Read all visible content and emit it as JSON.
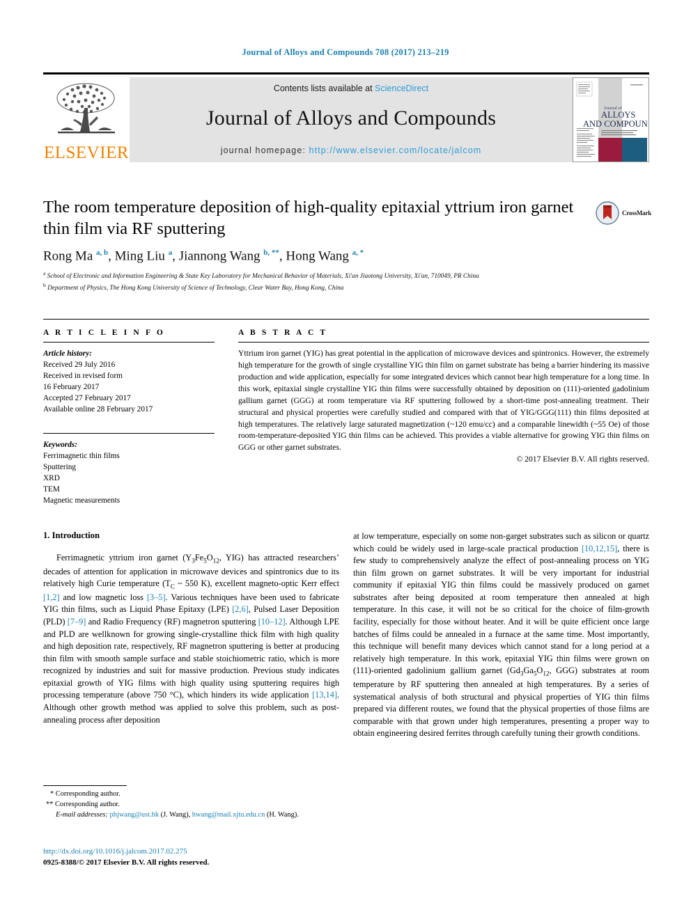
{
  "running_head": "Journal of Alloys and Compounds 708 (2017) 213–219",
  "masthead": {
    "publisher": "ELSEVIER",
    "contents_prefix": "Contents lists available at ",
    "contents_link": "ScienceDirect",
    "journal_title": "Journal of Alloys and Compounds",
    "homepage_prefix": "journal homepage: ",
    "homepage_url": "http://www.elsevier.com/locate/jalcom",
    "cover": {
      "line1": "Journal of",
      "line2": "ALLOYS",
      "line3": "AND COMPOUNDS"
    }
  },
  "article": {
    "title": "The room temperature deposition of high-quality epitaxial yttrium iron garnet thin film via RF sputtering",
    "crossmark_label": "CrossMark",
    "authors_html": "Rong Ma <sup>a, b</sup>, Ming Liu <sup>a</sup>, Jiannong Wang <sup>b, **</sup>, Hong Wang <sup>a, *</sup>",
    "affiliation_a": "School of Electronic and Information Engineering & State Key Laboratory for Mechanical Behavior of Materials, Xi'an Jiaotong University, Xi'an, 710049, PR China",
    "affiliation_b": "Department of Physics, The Hong Kong University of Science of Technology, Clear Water Bay, Hong Kong, China"
  },
  "info": {
    "heading": "A R T I C L E   I N F O",
    "history_label": "Article history:",
    "history": [
      "Received 29 July 2016",
      "Received in revised form",
      "16 February 2017",
      "Accepted 27 February 2017",
      "Available online 28 February 2017"
    ],
    "keywords_label": "Keywords:",
    "keywords": [
      "Ferrimagnetic thin films",
      "Sputtering",
      "XRD",
      "TEM",
      "Magnetic measurements"
    ]
  },
  "abstract": {
    "heading": "A B S T R A C T",
    "text": "Yttrium iron garnet (YIG) has great potential in the application of microwave devices and spintronics. However, the extremely high temperature for the growth of single crystalline YIG thin film on garnet substrate has being a barrier hindering its massive production and wide application, especially for some integrated devices which cannot bear high temperature for a long time. In this work, epitaxial single crystalline YIG thin films were successfully obtained by deposition on (111)-oriented gadolinium gallium garnet (GGG) at room temperature via RF sputtering followed by a short-time post-annealing treatment. Their structural and physical properties were carefully studied and compared with that of YIG/GGG(111) thin films deposited at high temperatures. The relatively large saturated magnetization (~120 emu/cc) and a comparable linewidth (~55 Oe) of those room-temperature-deposited YIG thin films can be achieved. This provides a viable alternative for growing YIG thin films on GGG or other garnet substrates.",
    "copyright": "© 2017 Elsevier B.V. All rights reserved."
  },
  "intro": {
    "section_number_title": "1.  Introduction",
    "left_paragraph_html": "Ferrimagnetic yttrium iron garnet (Y<sub>3</sub>Fe<sub>5</sub>O<sub>12</sub>, YIG) has attracted researchers&rsquo; decades of attention for application in microwave devices and spintronics due to its relatively high Curie temperature (T<sub>C</sub> ~ 550 K), excellent magneto-optic Kerr effect <span class=\"ref\">[1,2]</span> and low magnetic loss <span class=\"ref\">[3&ndash;5]</span>. Various techniques have been used to fabricate YIG thin films, such as Liquid Phase Epitaxy (LPE) <span class=\"ref\">[2,6]</span>, Pulsed Laser Deposition (PLD) <span class=\"ref\">[7&ndash;9]</span> and Radio Frequency (RF) magnetron sputtering <span class=\"ref\">[10&ndash;12]</span>. Although LPE and PLD are wellknown for growing single-crystalline thick film with high quality and high deposition rate, respectively, RF magnetron sputtering is better at producing thin film with smooth sample surface and stable stoichiometric ratio, which is more recognized by industries and suit for massive production. Previous study indicates epitaxial growth of YIG films with high quality using sputtering requires high processing temperature (above 750 &deg;C), which hinders its wide application <span class=\"ref\">[13,14]</span>. Although other growth method was applied to solve this problem, such as post-annealing process after deposition",
    "right_paragraph_html": "at low temperature, especially on some non-garget substrates such as silicon or quartz which could be widely used in large-scale practical production <span class=\"ref\">[10,12,15]</span>, there is few study to comprehensively analyze the effect of post-annealing process on YIG thin film grown on garnet substrates. It will be very important for industrial community if epitaxial YIG thin films could be massively produced on garnet substrates after being deposited at room temperature then annealed at high temperature. In this case, it will not be so critical for the choice of film-growth facility, especially for those without heater. And it will be quite efficient once large batches of films could be annealed in a furnace at the same time. Most importantly, this technique will benefit many devices which cannot stand for a long period at a relatively high temperature. In this work, epitaxial YIG thin films were grown on (111)-oriented gadolinium gallium garnet (Gd<sub>3</sub>Ga<sub>5</sub>O<sub>12</sub>, GGG) substrates at room temperature by RF sputtering then annealed at high temperatures. By a series of systematical analysis of both structural and physical properties of YIG thin films prepared via different routes, we found that the physical properties of those films are comparable with that grown under high temperatures, presenting a proper way to obtain engineering desired ferrites through carefully tuning their growth conditions."
  },
  "footnotes": {
    "corresponding_1": "* Corresponding author.",
    "corresponding_2": "** Corresponding author.",
    "email_label": "E-mail addresses:",
    "email_1": "phjwang@ust.hk",
    "email_1_owner": "(J. Wang),",
    "email_2": "hwang@mail.xjtu.edu.cn",
    "email_2_owner": "(H. Wang)."
  },
  "footer": {
    "doi": "http://dx.doi.org/10.1016/j.jalcom.2017.02.275",
    "issn_copyright": "0925-8388/© 2017 Elsevier B.V. All rights reserved."
  }
}
